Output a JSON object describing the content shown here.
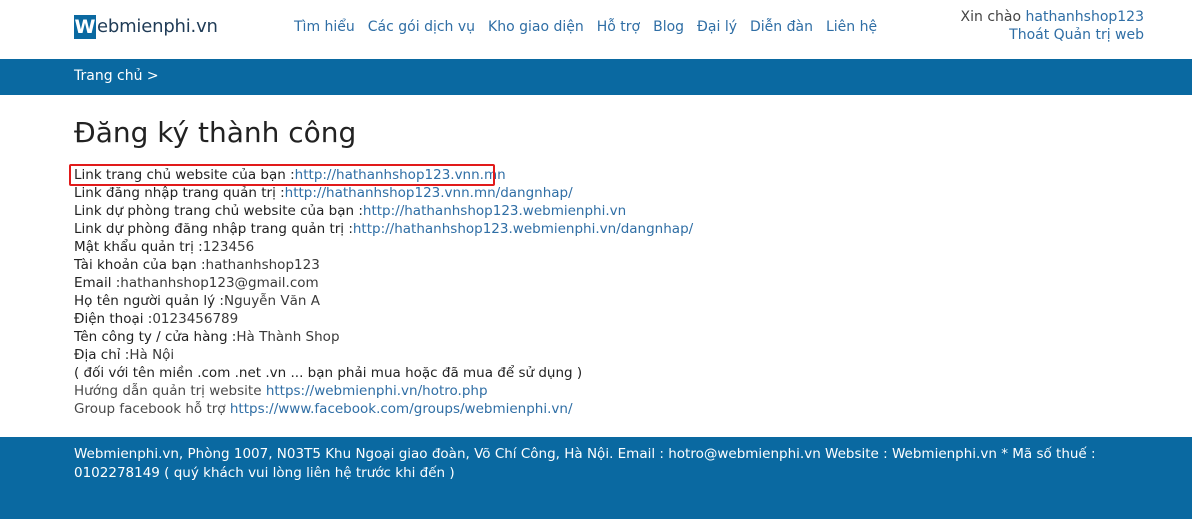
{
  "header": {
    "logo_letter": "W",
    "logo_text": "ebmienphi.vn",
    "nav": [
      "Tìm hiểu",
      "Các gói dịch vụ",
      "Kho giao diện",
      "Hỗ trợ",
      "Blog",
      "Đại lý",
      "Diễn đàn",
      "Liên hệ"
    ],
    "greeting": "Xin chào",
    "username": "hathanhshop123",
    "logout": "Thoát",
    "admin": "Quản trị web"
  },
  "breadcrumb": "Trang chủ >",
  "page_title": "Đăng ký thành công",
  "info": [
    {
      "label": "Link trang chủ website của bạn :",
      "value": "http://hathanhshop123.vnn.mn",
      "type": "link"
    },
    {
      "label": "Link đăng nhập trang quản trị :",
      "value": "http://hathanhshop123.vnn.mn/dangnhap/",
      "type": "link"
    },
    {
      "label": "Link dự phòng trang chủ website của bạn :",
      "value": "http://hathanhshop123.webmienphi.vn",
      "type": "link"
    },
    {
      "label": "Link dự phòng đăng nhập trang quản trị :",
      "value": "http://hathanhshop123.webmienphi.vn/dangnhap/",
      "type": "link"
    },
    {
      "label": "Mật khẩu quản trị :",
      "value": "123456",
      "type": "text"
    },
    {
      "label": "Tài khoản của bạn :",
      "value": "hathanhshop123",
      "type": "text"
    },
    {
      "label": "Email :",
      "value": "hathanhshop123@gmail.com",
      "type": "text"
    },
    {
      "label": "Họ tên người quản lý :",
      "value": "Nguyễn Văn A",
      "type": "text"
    },
    {
      "label": "Điện thoại :",
      "value": "0123456789",
      "type": "text"
    },
    {
      "label": "Tên công ty / cửa hàng :",
      "value": "Hà Thành Shop",
      "type": "text"
    },
    {
      "label": "Địa chỉ :",
      "value": "Hà Nội",
      "type": "text"
    }
  ],
  "domain_note": "( đối với tên miền .com .net .vn ... bạn phải mua hoặc đã mua để sử dụng )",
  "guide_label": "Hướng dẫn quản trị website",
  "guide_link": "https://webmienphi.vn/hotro.php",
  "group_label": "Group facebook hỗ trợ",
  "group_link": "https://www.facebook.com/groups/webmienphi.vn/",
  "footer": "Webmienphi.vn, Phòng 1007, N03T5 Khu Ngoại giao đoàn, Võ Chí Công, Hà Nội. Email : hotro@webmienphi.vn Website : Webmienphi.vn * Mã số thuế : 0102278149 ( quý khách vui lòng liên hệ trước khi đến )",
  "colors": {
    "brand": "#0a69a1",
    "link": "#2f6ea5",
    "highlight": "#e11a1a"
  }
}
